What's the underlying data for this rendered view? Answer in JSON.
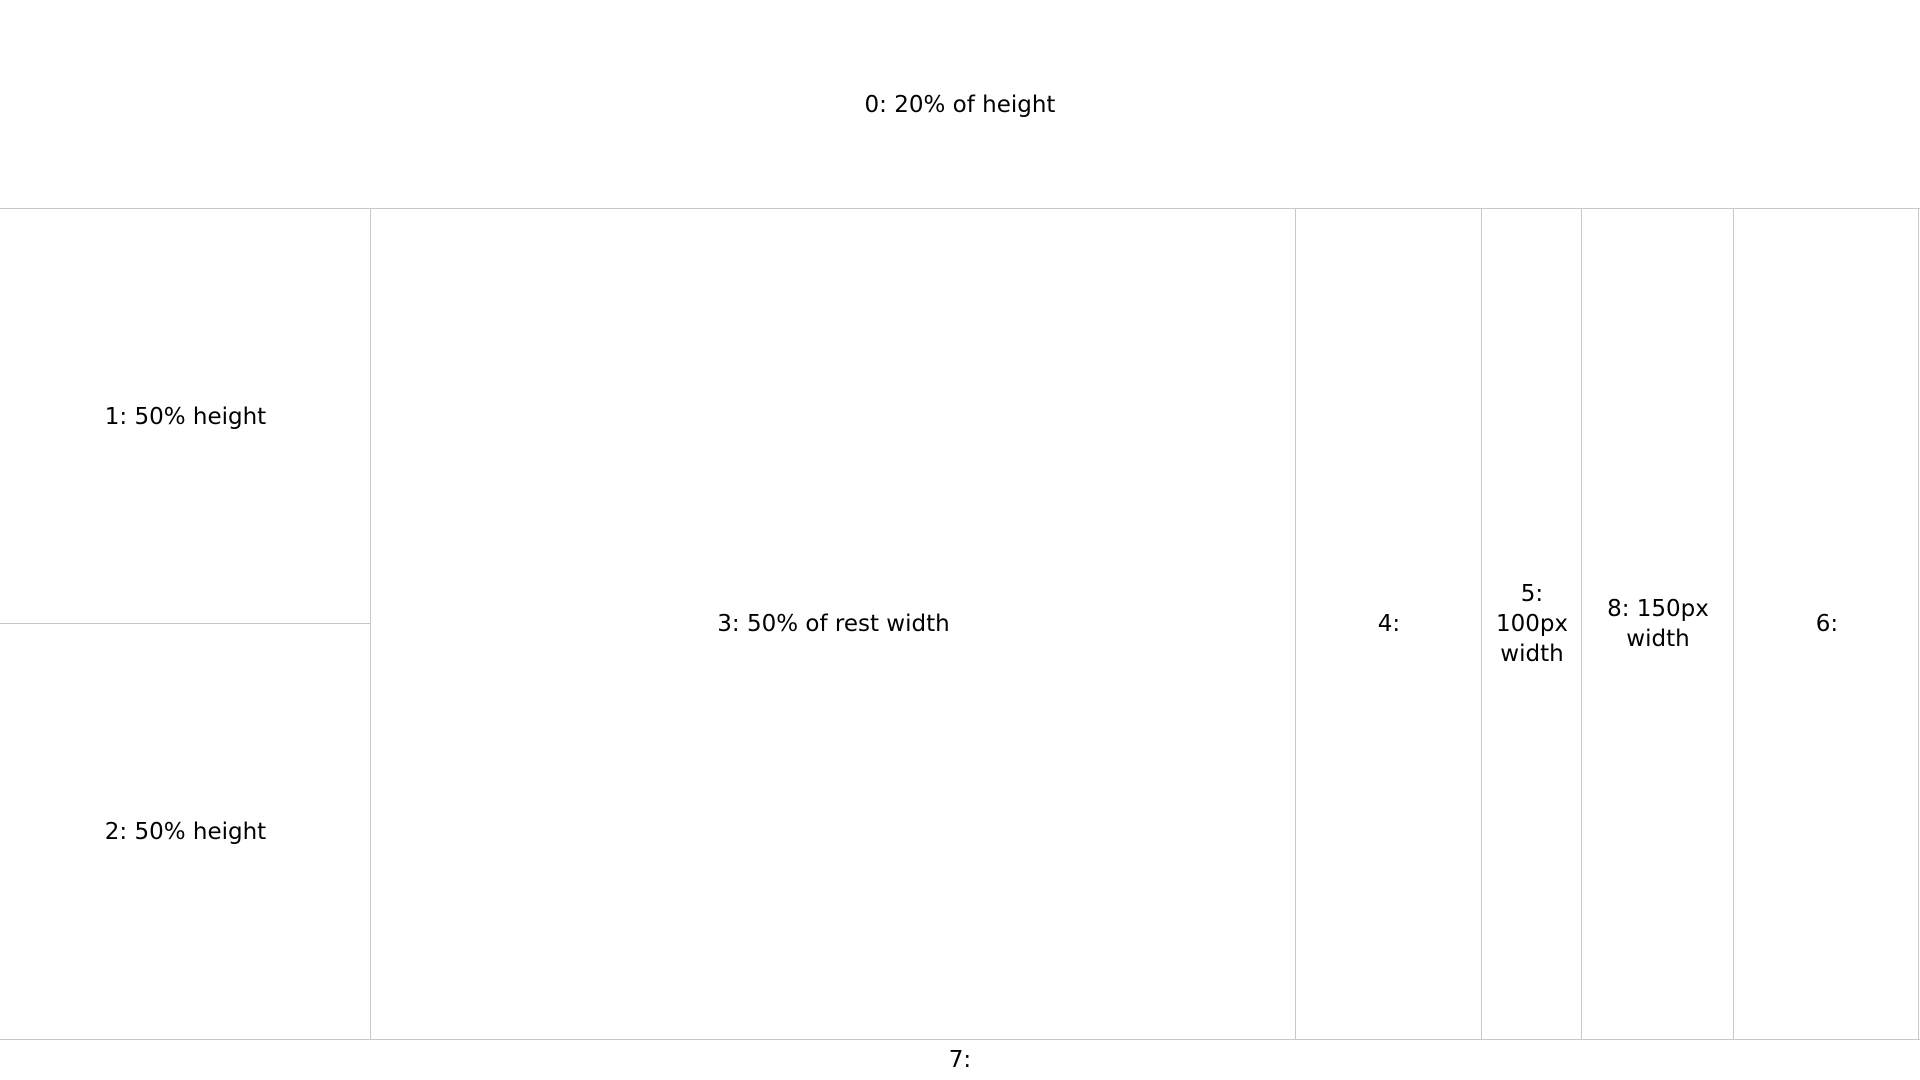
{
  "panes": [
    {
      "id": "0",
      "label": "0: 20% of height"
    },
    {
      "id": "1",
      "label": "1: 50% height"
    },
    {
      "id": "2",
      "label": "2: 50% height"
    },
    {
      "id": "3",
      "label": "3: 50% of rest width"
    },
    {
      "id": "4",
      "label": "4:"
    },
    {
      "id": "5",
      "label": "5: 100px width"
    },
    {
      "id": "8",
      "label": "8: 150px width"
    },
    {
      "id": "6",
      "label": "6:"
    },
    {
      "id": "7",
      "label": "7:"
    }
  ],
  "colors": {
    "background": "#ffffff",
    "divider": "#c8c8c8",
    "text": "#000000"
  }
}
